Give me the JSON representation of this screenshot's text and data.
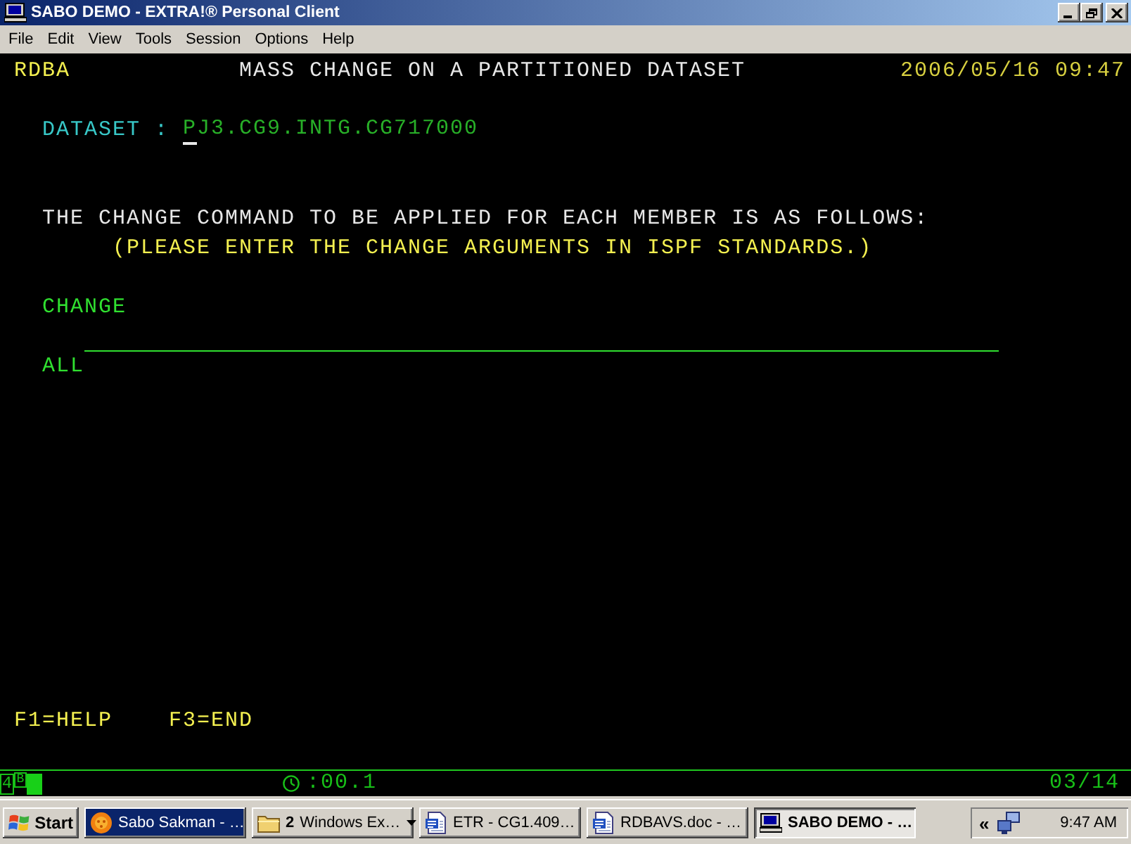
{
  "window": {
    "title": "SABO DEMO - EXTRA!® Personal Client"
  },
  "menu": [
    "File",
    "Edit",
    "View",
    "Tools",
    "Session",
    "Options",
    "Help"
  ],
  "terminal": {
    "header": {
      "program": "RDBA",
      "title": "MASS CHANGE ON A PARTITIONED DATASET",
      "timestamp": "2006/05/16 09:47"
    },
    "dataset": {
      "label": "DATASET :",
      "value": "PJ3.CG9.INTG.CG717000"
    },
    "instruction": "THE CHANGE COMMAND TO BE APPLIED FOR EACH MEMBER IS AS FOLLOWS:",
    "note": "(PLEASE ENTER THE CHANGE ARGUMENTS IN ISPF STANDARDS.)",
    "change_label": "CHANGE",
    "all_label": "ALL",
    "function_keys": [
      "F1=HELP",
      "F3=END"
    ]
  },
  "status_line": {
    "indicators": [
      "4",
      "B"
    ],
    "elapsed": ":00.1",
    "cursor_position": "03/14"
  },
  "taskbar": {
    "start": "Start",
    "tasks": [
      {
        "kind": "messenger",
        "label": "Sabo Sakman - …",
        "highlighted": true,
        "selected": false
      },
      {
        "kind": "folder",
        "count": "2",
        "label": "Windows Ex…",
        "highlighted": false,
        "selected": false
      },
      {
        "kind": "document",
        "label": "ETR - CG1.409…",
        "highlighted": false,
        "selected": false
      },
      {
        "kind": "document",
        "label": "RDBAVS.doc - …",
        "highlighted": false,
        "selected": false
      },
      {
        "kind": "terminal",
        "label": "SABO DEMO - …",
        "highlighted": false,
        "selected": true
      }
    ],
    "tray": {
      "expand": "«",
      "clock": "9:47 AM"
    }
  }
}
